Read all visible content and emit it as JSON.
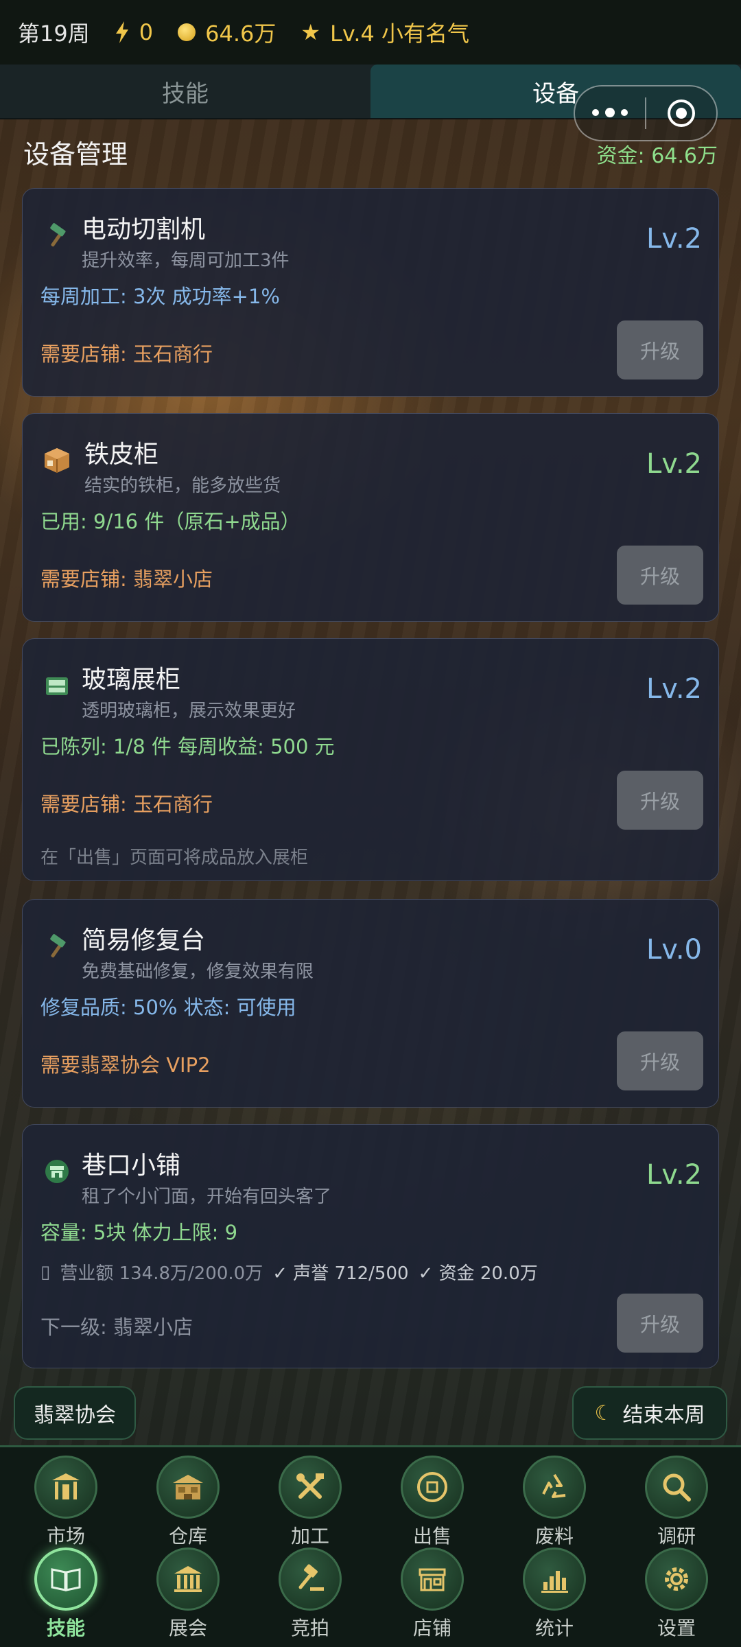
{
  "status": {
    "week": "第19周",
    "energy": "0",
    "money": "64.6万",
    "rank": "Lv.4 小有名气",
    "colors": {
      "gold": "#f0c64a",
      "green": "#8fd98f",
      "blue": "#86b8ea",
      "orange": "#e8a060"
    }
  },
  "tabs": [
    {
      "label": "技能",
      "active": false
    },
    {
      "label": "设备",
      "active": true
    }
  ],
  "header": {
    "title": "设备管理",
    "funds": "资金: 64.6万"
  },
  "cards": [
    {
      "icon": "hammer-icon",
      "name": "电动切割机",
      "desc": "提升效率，每周可加工3件",
      "level": "Lv.2",
      "line1": "每周加工: 3次  成功率+1%",
      "requirement": "需要店铺: 玉石商行",
      "button": "升级"
    },
    {
      "icon": "box-icon",
      "name": "铁皮柜",
      "desc": "结实的铁柜，能多放些货",
      "level": "Lv.2",
      "line1": "已用: 9/16 件（原石+成品）",
      "requirement": "需要店铺: 翡翠小店",
      "button": "升级"
    },
    {
      "icon": "cabinet-icon",
      "name": "玻璃展柜",
      "desc": "透明玻璃柜，展示效果更好",
      "level": "Lv.2",
      "line1": "已陈列: 1/8 件  每周收益: 500 元",
      "requirement": "需要店铺: 玉石商行",
      "button": "升级",
      "hint": "在「出售」页面可将成品放入展柜"
    },
    {
      "icon": "hammer-icon",
      "name": "简易修复台",
      "desc": "免费基础修复，修复效果有限",
      "level": "Lv.0",
      "line1": "修复品质: 50%  状态: 可使用",
      "requirement": "需要翡翠协会 VIP2",
      "button": "升级"
    },
    {
      "icon": "shop-icon",
      "name": "巷口小铺",
      "desc": "租了个小门面，开始有回头客了",
      "level": "Lv.2",
      "line1": "容量: 5块  体力上限: 9",
      "checks": [
        "营业额 134.8万/200.0万",
        "✓ 声誉 712/500",
        "✓ 资金 20.0万"
      ],
      "next": "下一级: 翡翠小店",
      "button": "升级"
    }
  ],
  "actions": {
    "association": "翡翠协会",
    "end_week": "结束本周"
  },
  "nav": [
    {
      "label": "市场",
      "icon": "gate-icon"
    },
    {
      "label": "仓库",
      "icon": "warehouse-icon"
    },
    {
      "label": "加工",
      "icon": "tools-icon"
    },
    {
      "label": "出售",
      "icon": "coin-icon"
    },
    {
      "label": "废料",
      "icon": "recycle-icon"
    },
    {
      "label": "调研",
      "icon": "magnifier-icon"
    },
    {
      "label": "技能",
      "icon": "book-icon",
      "active": true
    },
    {
      "label": "展会",
      "icon": "museum-icon"
    },
    {
      "label": "竞拍",
      "icon": "gavel-icon"
    },
    {
      "label": "店铺",
      "icon": "store-icon"
    },
    {
      "label": "统计",
      "icon": "chart-icon"
    },
    {
      "label": "设置",
      "icon": "gear-icon"
    }
  ]
}
